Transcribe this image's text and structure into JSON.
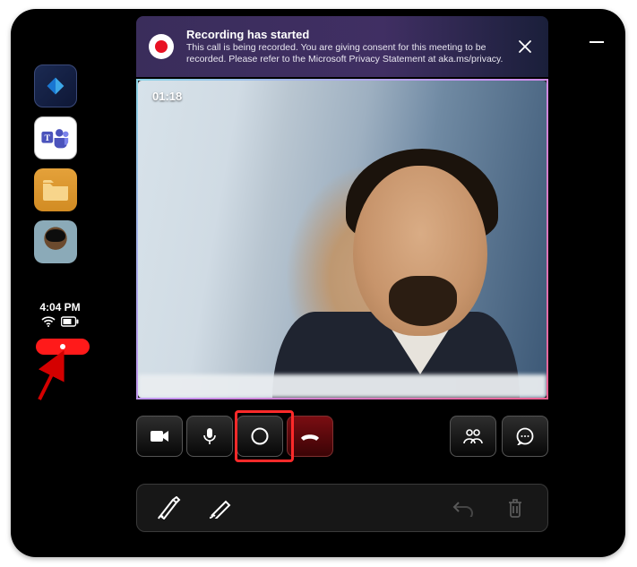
{
  "clock": "4:04 PM",
  "banner": {
    "title": "Recording has started",
    "subtitle": "This call is being recorded. You are giving consent for this meeting to be recorded. Please refer to the Microsoft Privacy Statement at aka.ms/privacy."
  },
  "call": {
    "timer": "01:18"
  },
  "sidebar": {
    "apps": [
      "power-app",
      "teams-app",
      "files-app",
      "contact-avatar"
    ]
  },
  "controls": {
    "camera": "camera",
    "mic": "mic",
    "record": "record",
    "hangup": "hangup",
    "people": "people",
    "chat": "chat"
  },
  "toolbar": {
    "stylus": "stylus",
    "pen": "pen",
    "undo": "undo",
    "trash": "trash"
  }
}
